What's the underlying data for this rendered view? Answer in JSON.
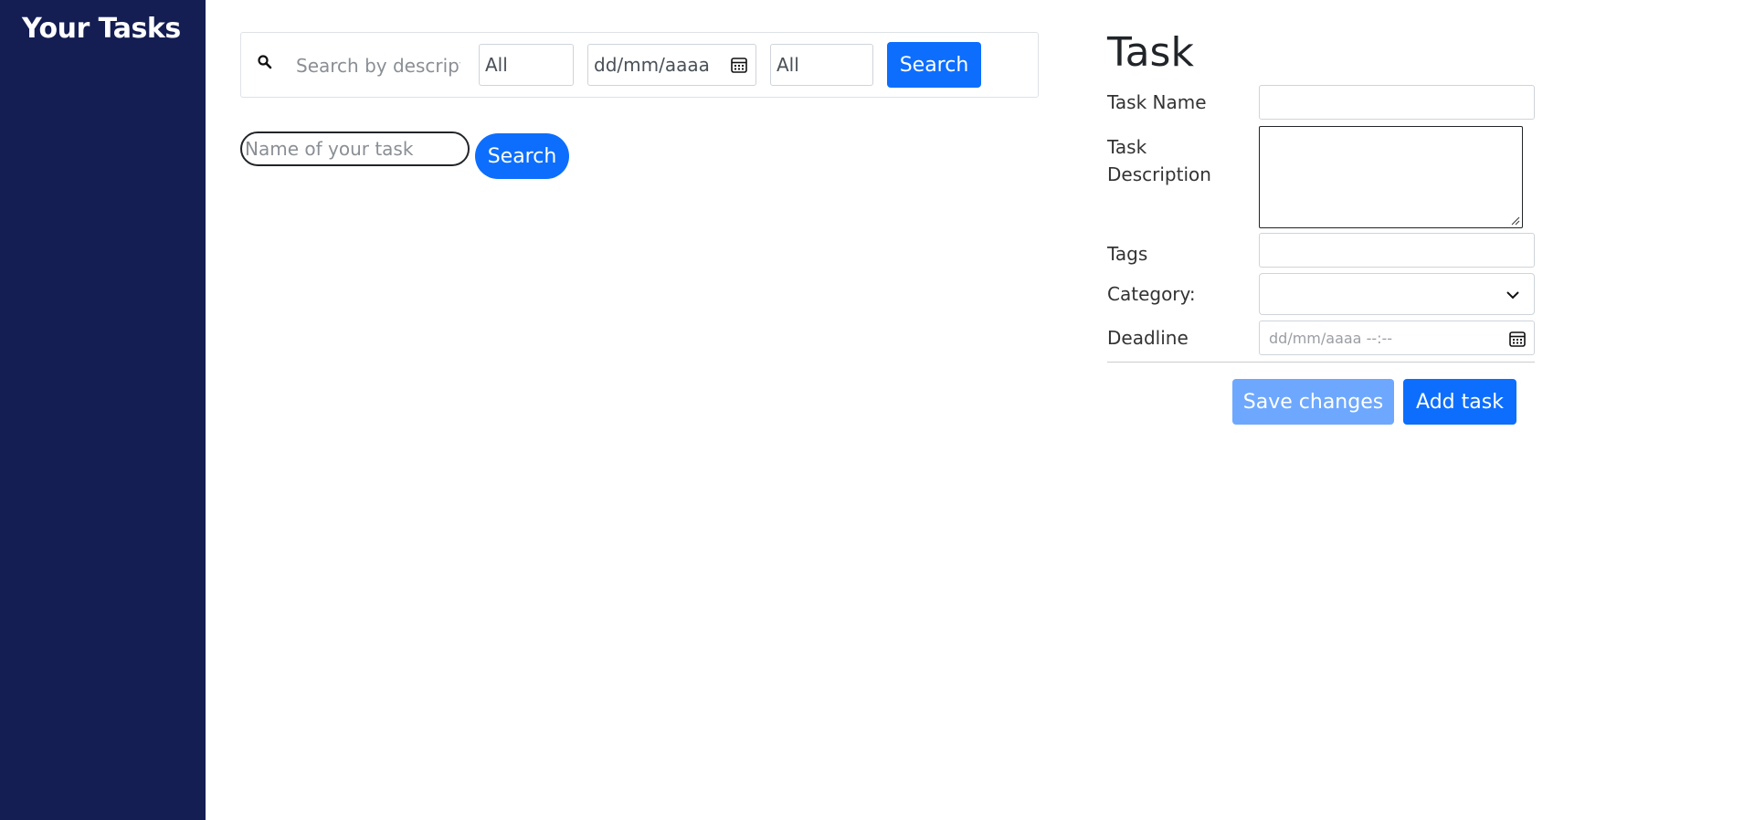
{
  "sidebar": {
    "title": "Your Tasks"
  },
  "filters": {
    "description_placeholder": "Search by description",
    "status_value": "All",
    "date_placeholder": "dd/mm/aaaa",
    "priority_value": "All",
    "search_label": "Search"
  },
  "name_search": {
    "placeholder": "Name of your task",
    "search_label": "Search"
  },
  "task_form": {
    "title": "Task",
    "name_label": "Task Name",
    "description_label": "Task Description",
    "tags_label": "Tags",
    "category_label": "Category:",
    "deadline_label": "Deadline",
    "deadline_placeholder": "dd/mm/aaaa --:--",
    "save_label": "Save changes",
    "add_label": "Add task"
  },
  "colors": {
    "sidebar_bg": "#141e52",
    "primary": "#0d6efd",
    "primary_disabled": "#6ea8fe"
  },
  "icons": [
    "search-icon",
    "calendar-icon",
    "chevron-down-icon",
    "resize-grip-icon"
  ]
}
